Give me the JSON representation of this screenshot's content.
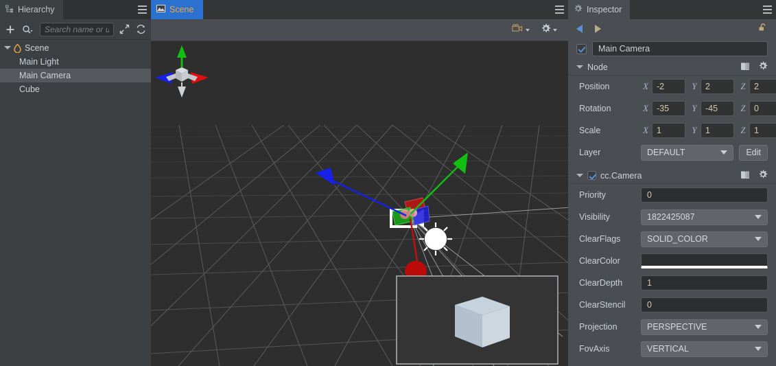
{
  "hierarchy": {
    "tab_label": "Hierarchy",
    "tab_icon": "hierarchy-tree-icon",
    "menu_icon": "hamburger-menu-icon",
    "toolbar": {
      "add_icon": "plus-icon",
      "search_icon": "search-icon",
      "search_placeholder": "Search name or u",
      "search_value": "",
      "expand_icon": "expand-arrows-icon",
      "refresh_icon": "refresh-icon"
    },
    "tree": [
      {
        "label": "Scene",
        "icon": "flame-icon",
        "depth": 0,
        "expanded": true,
        "selected": false
      },
      {
        "label": "Main Light",
        "depth": 1,
        "selected": false
      },
      {
        "label": "Main Camera",
        "depth": 1,
        "selected": true
      },
      {
        "label": "Cube",
        "depth": 1,
        "selected": false
      }
    ]
  },
  "scene": {
    "tab_label": "Scene",
    "tab_icon": "scene-image-icon",
    "menu_icon": "hamburger-menu-icon",
    "toolbar": {
      "camera_icon": "camera-icon",
      "gear_icon": "gear-icon"
    },
    "gizmo": {
      "axis_x_color": "#e01010",
      "axis_y_color": "#12c012",
      "axis_z_color": "#1520e8",
      "background_color": "#2e2e2e",
      "grid_color": "#6a6a6a"
    },
    "preview_label": "camera-preview"
  },
  "inspector": {
    "tab_label": "Inspector",
    "tab_icon": "gear-icon",
    "menu_icon": "hamburger-menu-icon",
    "nav": {
      "back_icon": "arrow-left-icon",
      "forward_icon": "arrow-right-icon",
      "lock_icon": "unlock-icon"
    },
    "node_enabled": true,
    "node_name": "Main Camera",
    "sections": [
      {
        "title": "Node",
        "expanded": true,
        "has_checkbox": false,
        "doc_icon": "book-icon",
        "gear_icon": "gear-icon",
        "rows": [
          {
            "type": "vec3",
            "label": "Position",
            "axes": [
              "X",
              "Y",
              "Z"
            ],
            "values": [
              "-2",
              "2",
              "2"
            ]
          },
          {
            "type": "vec3",
            "label": "Rotation",
            "axes": [
              "X",
              "Y",
              "Z"
            ],
            "values": [
              "-35",
              "-45",
              "0"
            ]
          },
          {
            "type": "vec3",
            "label": "Scale",
            "axes": [
              "X",
              "Y",
              "Z"
            ],
            "values": [
              "1",
              "1",
              "1"
            ]
          },
          {
            "type": "select-edit",
            "label": "Layer",
            "value": "DEFAULT",
            "button": "Edit"
          }
        ]
      },
      {
        "title": "cc.Camera",
        "expanded": true,
        "has_checkbox": true,
        "checked": true,
        "doc_icon": "book-icon",
        "gear_icon": "gear-icon",
        "rows": [
          {
            "type": "input",
            "label": "Priority",
            "value": "0"
          },
          {
            "type": "select",
            "label": "Visibility",
            "value": "1822425087"
          },
          {
            "type": "select",
            "label": "ClearFlags",
            "value": "SOLID_COLOR"
          },
          {
            "type": "color",
            "label": "ClearColor",
            "value": "#2b2d2f"
          },
          {
            "type": "input",
            "label": "ClearDepth",
            "value": "1"
          },
          {
            "type": "input",
            "label": "ClearStencil",
            "value": "0"
          },
          {
            "type": "select",
            "label": "Projection",
            "value": "PERSPECTIVE"
          },
          {
            "type": "select",
            "label": "FovAxis",
            "value": "VERTICAL"
          }
        ]
      }
    ]
  }
}
